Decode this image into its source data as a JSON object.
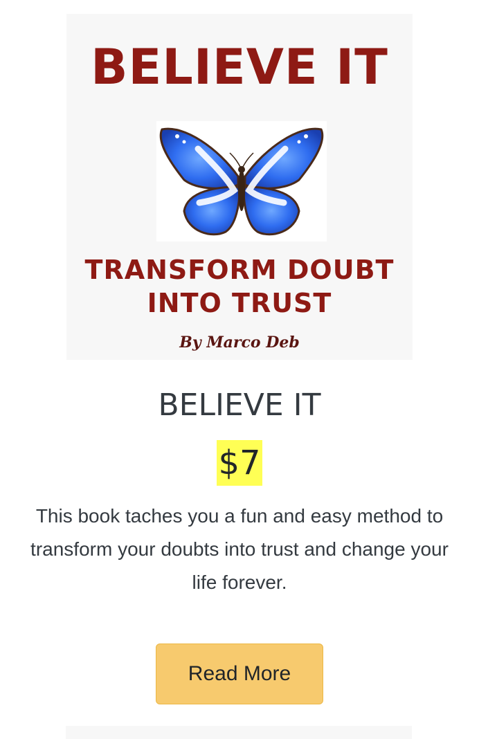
{
  "product": {
    "cover": {
      "heading": "BELIEVE IT",
      "subtitle": "TRANSFORM DOUBT INTO TRUST",
      "author": "By Marco Deb",
      "image_icon": "butterfly-icon"
    },
    "title": "BELIEVE IT",
    "price": "$7",
    "description": "This book taches you a fun and easy method to transform your doubts into trust and change your life forever.",
    "button_label": "Read More"
  },
  "colors": {
    "cover_text": "#8e1a14",
    "price_highlight": "#ffff55",
    "button_bg": "#f7ca6e",
    "text": "#343a40"
  }
}
